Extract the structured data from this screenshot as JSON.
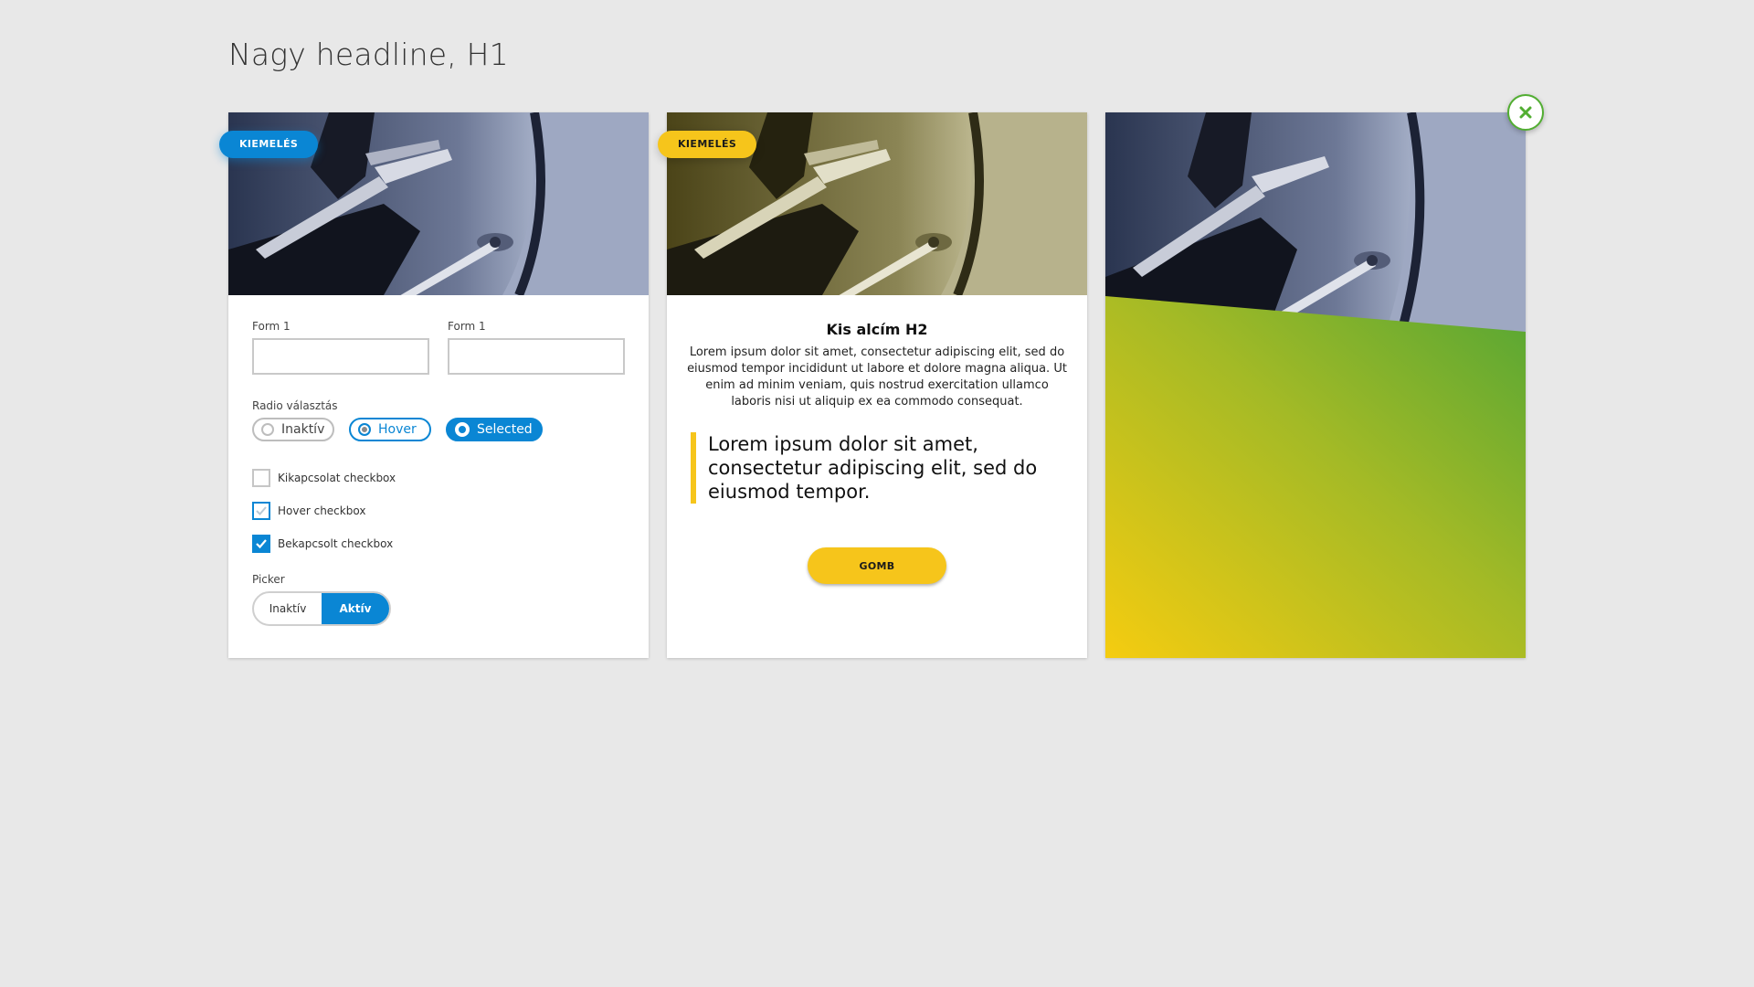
{
  "headline": "Nagy headline, H1",
  "colors": {
    "blue": "#0a86d4",
    "yellow": "#f6c51b",
    "green": "#52ae32",
    "background": "#e8e8e8"
  },
  "card1": {
    "badge": "KIEMELÉS",
    "form1_label": "Form 1",
    "form2_label": "Form 1",
    "form1_value": "",
    "form2_value": "",
    "radio_group_label": "Radio választás",
    "radios": [
      {
        "label": "Inaktív",
        "state": "inactive"
      },
      {
        "label": "Hover",
        "state": "hover"
      },
      {
        "label": "Selected",
        "state": "selected"
      }
    ],
    "checkboxes": [
      {
        "label": "Kikapcsolat checkbox",
        "state": "off"
      },
      {
        "label": "Hover checkbox",
        "state": "hover"
      },
      {
        "label": "Bekapcsolt checkbox",
        "state": "on"
      }
    ],
    "picker_label": "Picker",
    "picker_options": [
      {
        "label": "Inaktív",
        "active": false
      },
      {
        "label": "Aktív",
        "active": true
      }
    ]
  },
  "card2": {
    "badge": "KIEMELÉS",
    "title": "Kis alcím H2",
    "body": "Lorem ipsum dolor sit amet, consectetur adipiscing elit, sed do eiusmod tempor incididunt ut labore et dolore magna aliqua. Ut enim ad minim veniam, quis nostrud exercitation ullamco laboris nisi ut aliquip ex ea commodo consequat.",
    "quote": "Lorem ipsum dolor sit amet, consectetur adipiscing elit, sed do eiusmod tempor.",
    "button": "GOMB"
  },
  "card3": {
    "close_icon": "close-icon"
  }
}
